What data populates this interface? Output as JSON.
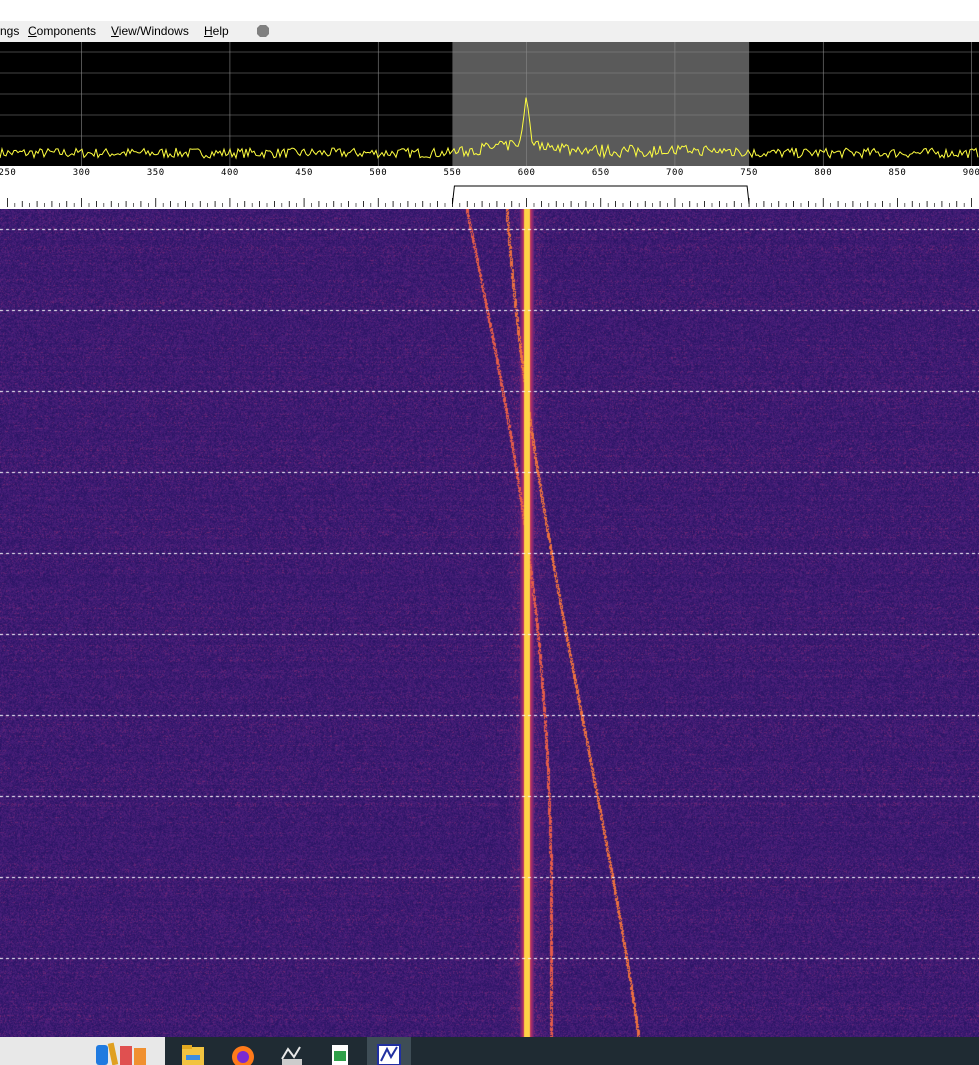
{
  "menu": {
    "items": [
      {
        "pre": "",
        "ul": "",
        "post": "ngs",
        "name": "menu-settings"
      },
      {
        "pre": "",
        "ul": "C",
        "post": "omponents",
        "name": "menu-components"
      },
      {
        "pre": "",
        "ul": "V",
        "post": "iew/Windows",
        "name": "menu-view-windows"
      },
      {
        "pre": "",
        "ul": "H",
        "post": "elp",
        "name": "menu-help"
      }
    ]
  },
  "spectrum": {
    "passband_low_hz": 550,
    "passband_high_hz": 750,
    "peak_hz": 600,
    "axis_min_hz": 245,
    "axis_max_hz": 905
  },
  "ruler": {
    "labels": [
      "250",
      "300",
      "350",
      "400",
      "450",
      "500",
      "550",
      "600",
      "650",
      "700",
      "750",
      "800",
      "850",
      "900"
    ]
  },
  "colors": {
    "waterfall_background": "#2a1b6b",
    "signal_core": "#ffd040",
    "trace_yellow": "#ffff40",
    "passband_gray": "#5a5a5a",
    "status_dot": "#808080"
  },
  "taskbar": {
    "icons": [
      {
        "name": "paint-apps-icon"
      },
      {
        "name": "file-explorer-icon"
      },
      {
        "name": "firefox-icon"
      },
      {
        "name": "morse-app-icon"
      },
      {
        "name": "spreadsheet-icon"
      },
      {
        "name": "sdr-app-icon"
      }
    ]
  }
}
